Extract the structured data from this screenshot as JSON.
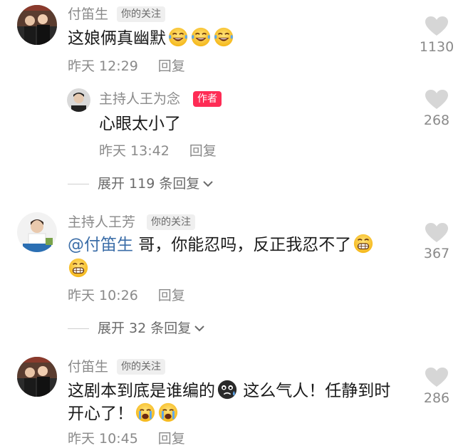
{
  "comments": [
    {
      "username": "付笛生",
      "badge": "你的关注",
      "text": "这娘俩真幽默",
      "time": "昨天 12:29",
      "reply_label": "回复",
      "likes": "1130",
      "emojis": [
        "laughing-tears-emoji",
        "laughing-tears-emoji",
        "laughing-tears-emoji"
      ]
    },
    {
      "username": "主持人王为念",
      "badge": "作者",
      "text": "心眼太小了",
      "time": "昨天 13:42",
      "reply_label": "回复",
      "likes": "268"
    },
    {
      "username": "主持人王芳",
      "badge": "你的关注",
      "mention": "@付笛生",
      "text_line1": " 哥，你能忍吗，反正我忍不了",
      "time": "昨天 10:26",
      "reply_label": "回复",
      "likes": "367",
      "emojis": [
        "grinning-emoji",
        "grinning-emoji"
      ]
    },
    {
      "username": "付笛生",
      "badge": "你的关注",
      "text_line1a": "这剧本到底是谁编的",
      "text_line1b": " 这么气人！任静到时",
      "text_line2": "开心了！",
      "time": "昨天 10:45",
      "reply_label": "回复",
      "likes": "286",
      "emojis": [
        "crying-black-face-emoji",
        "crying-emoji",
        "crying-emoji"
      ]
    }
  ],
  "expanders": [
    {
      "label": "展开 119 条回复"
    },
    {
      "label": "展开 32 条回复"
    }
  ],
  "colors": {
    "author_badge": "#fe2c55",
    "mention": "#3c6ea8",
    "meta_gray": "#8a8a8a"
  }
}
